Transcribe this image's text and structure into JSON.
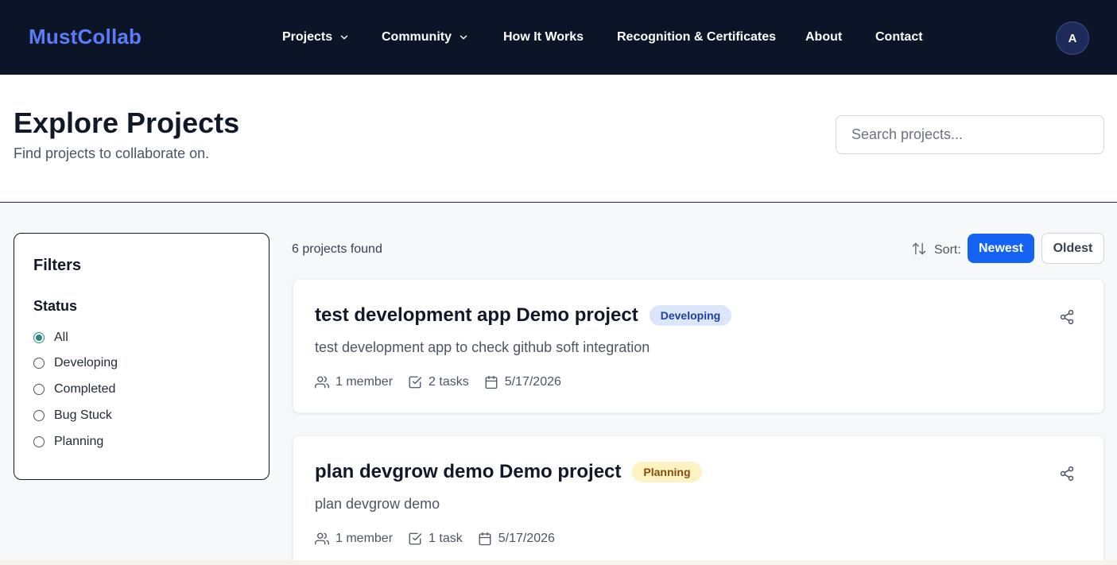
{
  "app": {
    "logo": "MustCollab"
  },
  "nav": {
    "items": [
      {
        "label": "Projects",
        "dropdown": true
      },
      {
        "label": "Community",
        "dropdown": true
      },
      {
        "label": "How It Works",
        "dropdown": false
      },
      {
        "label": "Recognition & Certificates",
        "dropdown": false
      },
      {
        "label": "About",
        "dropdown": false
      },
      {
        "label": "Contact",
        "dropdown": false
      }
    ],
    "avatar": "A"
  },
  "header": {
    "title": "Explore Projects",
    "subtitle": "Find projects to collaborate on.",
    "search_placeholder": "Search projects..."
  },
  "filters": {
    "title": "Filters",
    "status_label": "Status",
    "options": [
      {
        "label": "All",
        "checked": true
      },
      {
        "label": "Developing",
        "checked": false
      },
      {
        "label": "Completed",
        "checked": false
      },
      {
        "label": "Bug Stuck",
        "checked": false
      },
      {
        "label": "Planning",
        "checked": false
      }
    ]
  },
  "results": {
    "count": "6 projects found",
    "sort_label": "Sort:",
    "sort_newest": "Newest",
    "sort_oldest": "Oldest"
  },
  "projects": [
    {
      "title": "test development app Demo project",
      "status": "Developing",
      "description": "test development app to check github soft integration",
      "members": "1 member",
      "tasks": "2 tasks",
      "date": "5/17/2026"
    },
    {
      "title": "plan devgrow demo Demo project",
      "status": "Planning",
      "description": "plan devgrow demo",
      "members": "1 member",
      "tasks": "1 task",
      "date": "5/17/2026"
    }
  ],
  "colors": {
    "navbar_bg": "#0c1527",
    "logo": "#5b7cf7",
    "primary": "#1463f3",
    "radio_checked": "#2a8a7f",
    "badge_developing_bg": "#dbe6fb",
    "badge_planning_bg": "#fdf3c2"
  }
}
